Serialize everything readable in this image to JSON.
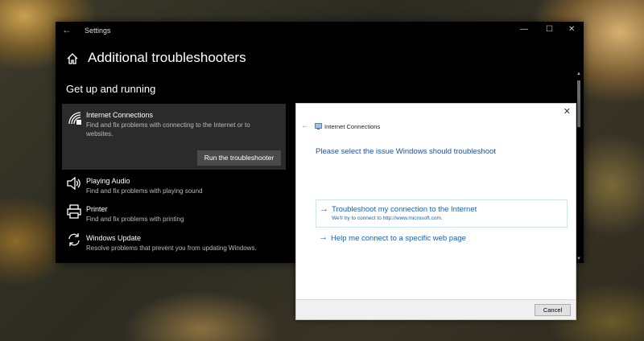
{
  "settings_window": {
    "title": "Settings",
    "back_glyph": "←",
    "controls": {
      "minimize": "—",
      "maximize": "☐",
      "close": "✕"
    },
    "page_title": "Additional troubleshooters",
    "section_title": "Get up and running",
    "items": [
      {
        "name": "Internet Connections",
        "description_line1": "Find and fix problems with connecting to the Internet or to",
        "description_line2": "websites.",
        "icon": "wifi-icon",
        "selected": true,
        "button_label": "Run the troubleshooter"
      },
      {
        "name": "Playing Audio",
        "description": "Find and fix problems with playing sound",
        "icon": "speaker-icon"
      },
      {
        "name": "Printer",
        "description": "Find and fix problems with printing",
        "icon": "printer-icon"
      },
      {
        "name": "Windows Update",
        "description": "Resolve problems that prevent you from updating Windows.",
        "icon": "refresh-icon"
      }
    ]
  },
  "dialog": {
    "app_title": "Internet Connections",
    "heading": "Please select the issue Windows should troubleshoot",
    "options": [
      {
        "title": "Troubleshoot my connection to the Internet",
        "subtitle": "We'll try to connect to http://www.microsoft.com."
      },
      {
        "title": "Help me connect to a specific web page"
      }
    ],
    "cancel_label": "Cancel",
    "close_glyph": "✕",
    "back_glyph": "←",
    "arrow_glyph": "→"
  },
  "colors": {
    "accent": "#1a5fb4",
    "heading": "#1f4fa0",
    "settings_bg": "#000000",
    "selected_item": "#2b2b2b"
  }
}
